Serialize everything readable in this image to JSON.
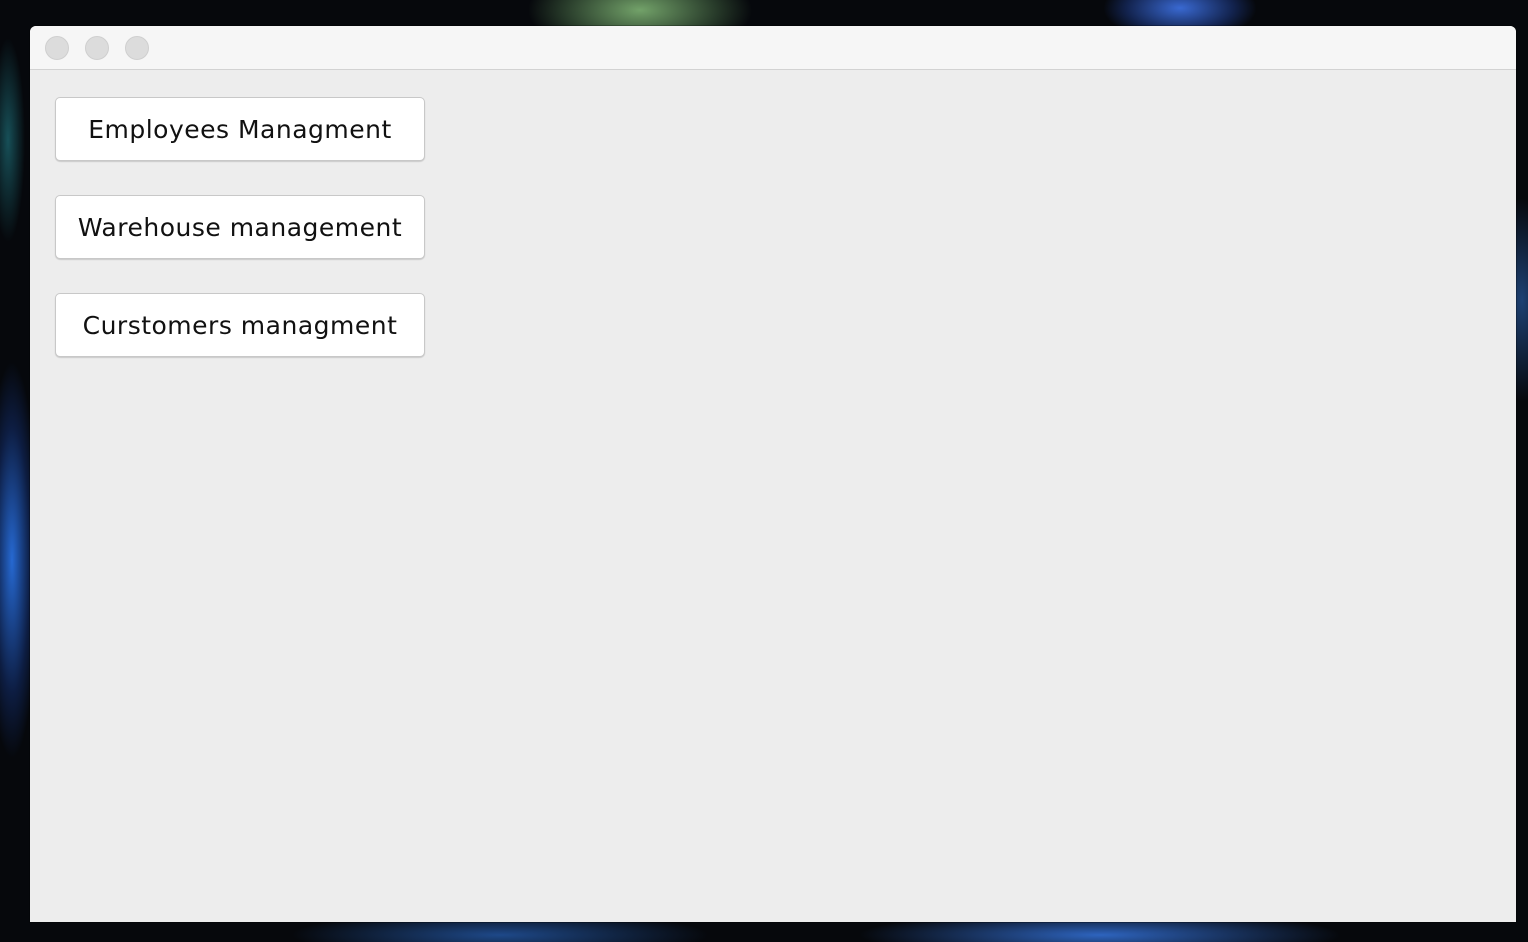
{
  "window": {
    "title": ""
  },
  "main": {
    "buttons": [
      {
        "label": "Employees Managment"
      },
      {
        "label": "Warehouse management"
      },
      {
        "label": "Curstomers managment"
      }
    ]
  },
  "colors": {
    "window_background": "#ededed",
    "titlebar": "#f6f6f6",
    "button_background": "#ffffff",
    "traffic_light_inactive": "#dcdcdc"
  }
}
